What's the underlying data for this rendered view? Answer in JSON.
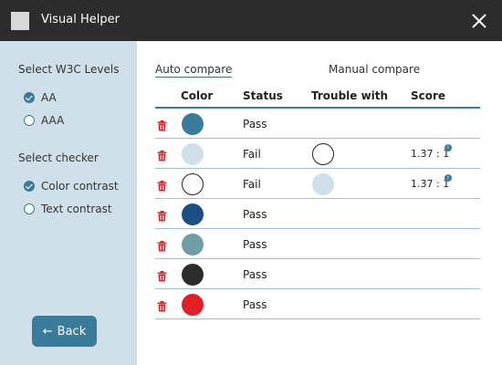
{
  "app": {
    "title": "Visual Helper",
    "logo_color": "#d8d8d8",
    "close_icon": "close-icon"
  },
  "sidebar": {
    "levels_title": "Select W3C Levels",
    "levels": [
      {
        "label": "AA",
        "checked": true
      },
      {
        "label": "AAA",
        "checked": false
      }
    ],
    "checker_title": "Select checker",
    "checkers": [
      {
        "label": "Color contrast",
        "checked": true
      },
      {
        "label": "Text contrast",
        "checked": false
      }
    ],
    "back_label": "Back",
    "back_icon": "arrow-left-icon"
  },
  "tabs": [
    {
      "label": "Auto compare",
      "active": true
    },
    {
      "label": "Manual compare",
      "active": false
    }
  ],
  "table": {
    "headers": {
      "color": "Color",
      "status": "Status",
      "trouble": "Trouble with",
      "score": "Score"
    },
    "rows": [
      {
        "color": "#3a7b9c",
        "status": "Pass",
        "trouble": null,
        "score": ""
      },
      {
        "color": "#cfe0ea",
        "status": "Fail",
        "trouble": "#ffffff",
        "score": "1.37 : 1"
      },
      {
        "color": "#ffffff",
        "status": "Fail",
        "trouble": "#cfe0ea",
        "score": "1.37 : 1"
      },
      {
        "color": "#1e4f84",
        "status": "Pass",
        "trouble": null,
        "score": ""
      },
      {
        "color": "#709ea5",
        "status": "Pass",
        "trouble": null,
        "score": ""
      },
      {
        "color": "#2c2c2c",
        "status": "Pass",
        "trouble": null,
        "score": ""
      },
      {
        "color": "#e21f26",
        "status": "Pass",
        "trouble": null,
        "score": ""
      }
    ]
  },
  "colors": {
    "accent": "#3a7b9c",
    "sidebar_bg": "#cfe0ea",
    "titlebar_bg": "#2c2c2c",
    "delete": "#d3262b"
  }
}
